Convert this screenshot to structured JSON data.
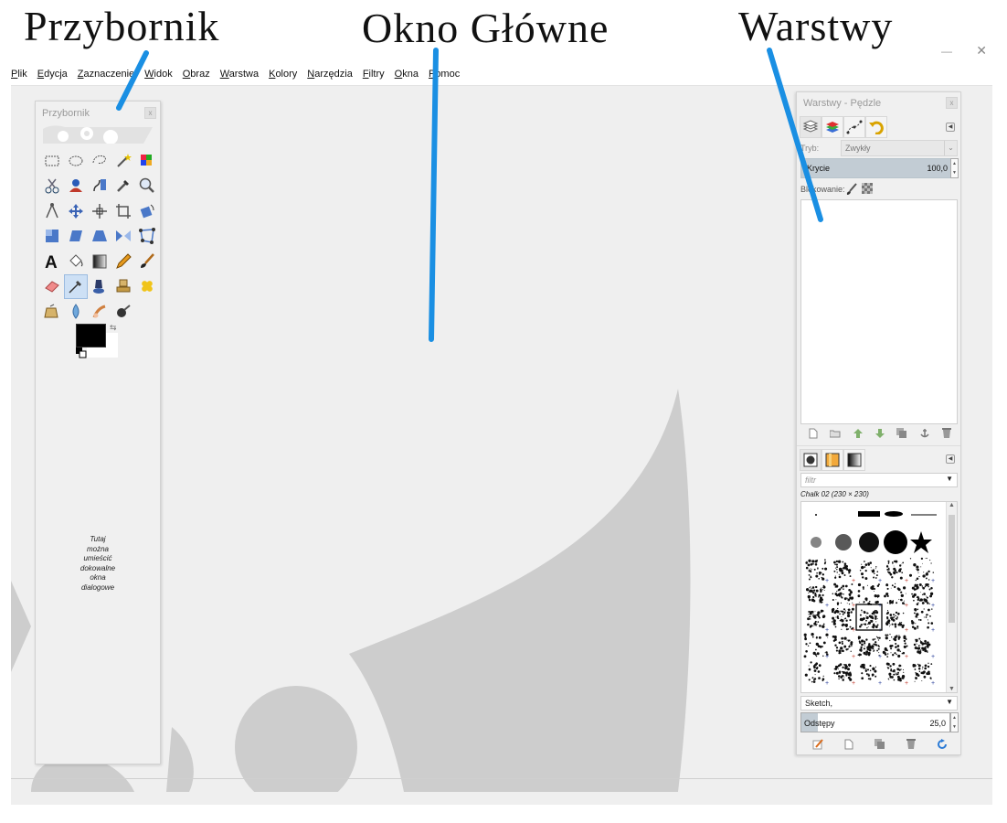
{
  "annotations": {
    "toolbox_label": "Przybornik",
    "main_label": "Okno Główne",
    "layers_label": "Warstwy"
  },
  "menu": [
    "Plik",
    "Edycja",
    "Zaznaczenie",
    "Widok",
    "Obraz",
    "Warstwa",
    "Kolory",
    "Narzędzia",
    "Filtry",
    "Okna",
    "Pomoc"
  ],
  "toolbox": {
    "title": "Przybornik",
    "close_glyph": "x",
    "dock_hint": [
      "Tutaj",
      "można",
      "umieścić",
      "dokowalne",
      "okna",
      "dialogowe"
    ],
    "tools": [
      "rect-select-icon",
      "ellipse-select-icon",
      "free-select-icon",
      "fuzzy-select-icon",
      "color-select-icon",
      "scissors-select-icon",
      "foreground-select-icon",
      "paths-icon",
      "color-picker-icon",
      "zoom-icon",
      "measure-icon",
      "move-icon",
      "align-icon",
      "crop-icon",
      "rotate-icon",
      "scale-icon",
      "shear-icon",
      "perspective-icon",
      "flip-icon",
      "cage-icon",
      "text-icon",
      "bucket-fill-icon",
      "blend-icon",
      "pencil-icon",
      "paintbrush-icon",
      "eraser-icon",
      "airbrush-icon",
      "ink-icon",
      "clone-icon",
      "heal-icon",
      "perspective-clone-icon",
      "blur-icon",
      "smudge-icon",
      "dodge-burn-icon"
    ],
    "active_tool_index": 26,
    "colors": {
      "foreground": "#000000",
      "background": "#ffffff"
    }
  },
  "dock": {
    "title": "Warstwy - Pędzle",
    "close_glyph": "x",
    "layers": {
      "mode_label": "Tryb:",
      "mode_value": "Zwykły",
      "opacity_label": "Krycie",
      "opacity_value": "100,0",
      "lock_label": "Blokowanie:"
    },
    "brushes": {
      "filter_placeholder": "filtr",
      "selected_brush": "Chalk 02 (230 × 230)",
      "preset": "Sketch,",
      "spacing_label": "Odstępy",
      "spacing_value": "25,0"
    }
  },
  "colors": {
    "pointer": "#1a8fe3",
    "canvas": "#efefef",
    "wilber": "#cdcdcd",
    "opacity_fill": "#c2ccd4"
  }
}
